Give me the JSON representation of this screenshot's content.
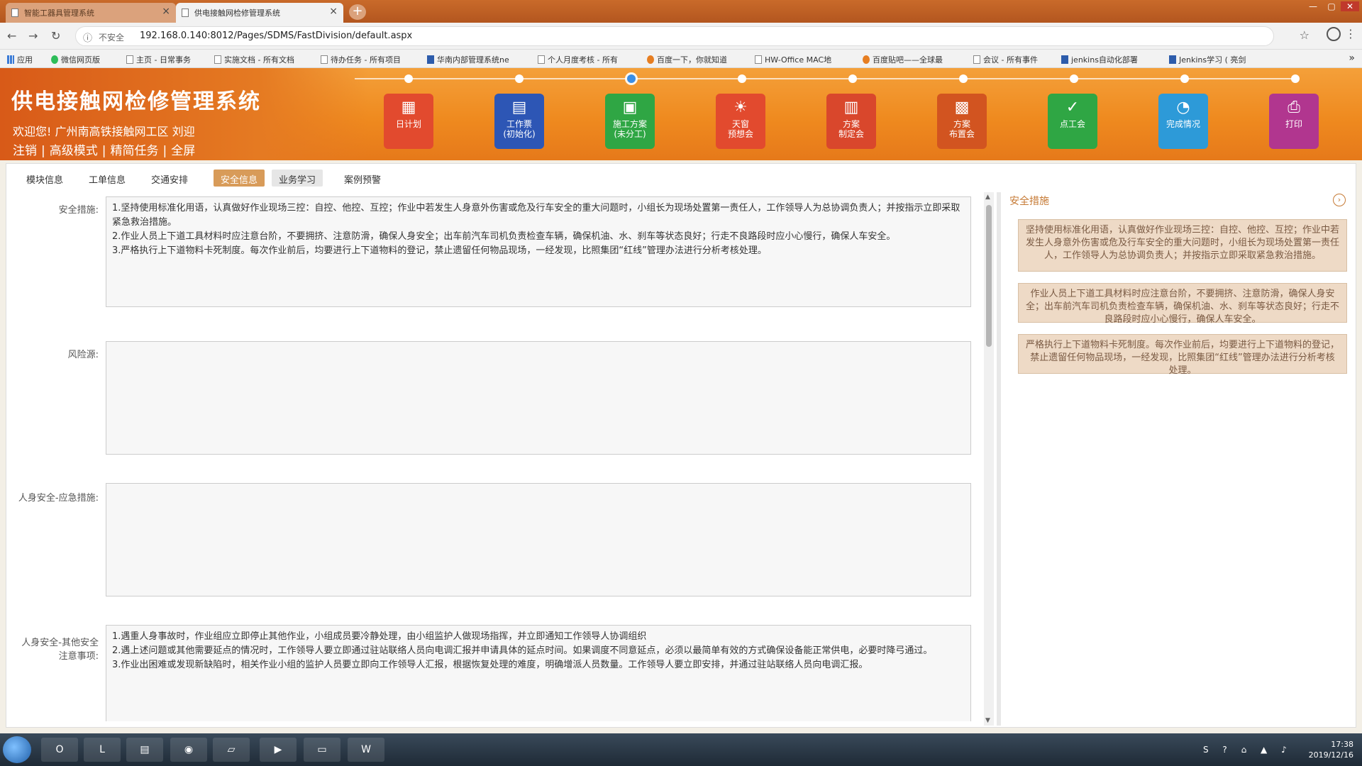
{
  "browser": {
    "tabs": [
      {
        "label": "智能工器具管理系统",
        "active": false
      },
      {
        "label": "供电接触网检修管理系统",
        "active": true
      }
    ],
    "security_label": "不安全",
    "url": "192.168.0.140:8012/Pages/SDMS/FastDivision/default.aspx",
    "bookmarks": [
      {
        "label": "应用",
        "icon": "apps-grid-icon"
      },
      {
        "label": "微信网页版",
        "icon": "wechat-icon"
      },
      {
        "label": "主页 - 日常事务",
        "icon": "page-icon"
      },
      {
        "label": "实施文档 - 所有文档",
        "icon": "page-icon"
      },
      {
        "label": "待办任务 - 所有项目",
        "icon": "page-icon"
      },
      {
        "label": "华南内部管理系统ne",
        "icon": "huawei-icon"
      },
      {
        "label": "个人月度考核 - 所有",
        "icon": "page-icon"
      },
      {
        "label": "百度一下，你就知道",
        "icon": "baidu-icon"
      },
      {
        "label": "HW-Office MAC地",
        "icon": "page-icon"
      },
      {
        "label": "百度贴吧——全球最",
        "icon": "baidu-icon"
      },
      {
        "label": "会议 - 所有事件",
        "icon": "page-icon"
      },
      {
        "label": "jenkins自动化部署",
        "icon": "confluence-icon"
      },
      {
        "label": "Jenkins学习 ( 亮剑",
        "icon": "confluence-icon"
      }
    ]
  },
  "header": {
    "title": "供电接触网检修管理系统",
    "welcome": "欢迎您! 广州南高铁接触网工区 刘迎",
    "links": [
      "注销",
      "高级模式",
      "精简任务",
      "全屏"
    ],
    "modules": [
      {
        "line1": "日计划",
        "line2": "",
        "icon": "calendar-plan-icon",
        "color": "#e24a2e"
      },
      {
        "line1": "工作票",
        "line2": "(初始化)",
        "icon": "ticket-icon",
        "color": "#2d56b5"
      },
      {
        "line1": "施工方案",
        "line2": "(未分工)",
        "icon": "document-plan-icon",
        "color": "#2fa644"
      },
      {
        "line1": "天窗",
        "line2": "预想会",
        "icon": "lightbulb-icon",
        "color": "#e24a2e"
      },
      {
        "line1": "方案",
        "line2": "制定会",
        "icon": "document-plan-icon",
        "color": "#d9472c"
      },
      {
        "line1": "方案",
        "line2": "布置会",
        "icon": "meeting-icon",
        "color": "#d25420"
      },
      {
        "line1": "点工会",
        "line2": "",
        "icon": "check-circle-icon",
        "color": "#2fa644"
      },
      {
        "line1": "完成情况",
        "line2": "",
        "icon": "pie-chart-icon",
        "color": "#2d9ad8"
      },
      {
        "line1": "打印",
        "line2": "",
        "icon": "printer-icon",
        "color": "#b1368f"
      }
    ]
  },
  "subtabs": [
    {
      "label": "模块信息",
      "state": "normal"
    },
    {
      "label": "工单信息",
      "state": "normal"
    },
    {
      "label": "交通安排",
      "state": "normal"
    },
    {
      "label": "安全信息",
      "state": "active"
    },
    {
      "label": "业务学习",
      "state": "hover"
    },
    {
      "label": "案例预警",
      "state": "normal"
    }
  ],
  "form": {
    "safety_measures": {
      "label": "安全措施:",
      "lines": [
        "1.坚持使用标准化用语，认真做好作业现场三控：自控、他控、互控；作业中若发生人身意外伤害或危及行车安全的重大问题时，小组长为现场处置第一责任人，工作领导人为总协调负责人；并按指示立即采取紧急救治措施。",
        "2.作业人员上下道工具材料时应注意台阶，不要拥挤、注意防滑，确保人身安全；出车前汽车司机负责检查车辆，确保机油、水、刹车等状态良好；行走不良路段时应小心慢行，确保人车安全。",
        "3.严格执行上下道物料卡死制度。每次作业前后，均要进行上下道物料的登记，禁止遗留任何物品现场，一经发现，比照集团“红线”管理办法进行分析考核处理。"
      ]
    },
    "risk_source": {
      "label": "风险源:",
      "value": ""
    },
    "personal_safety_emergency": {
      "label": "人身安全-应急措施:",
      "value": ""
    },
    "personal_safety_other": {
      "label": "人身安全-其他安全注意事项:",
      "lines": [
        "1.遇重人身事故时，作业组应立即停止其他作业，小组成员要冷静处理，由小组监护人做现场指挥，并立即通知工作领导人协调组织",
        "2.遇上述问题或其他需要延点的情况时，工作领导人要立即通过驻站联络人员向电调汇报并申请具体的延点时间。如果调度不同意延点，必须以最简单有效的方式确保设备能正常供电，必要时降弓通过。",
        "3.作业出困难或发现新缺陷时，相关作业小组的监护人员要立即向工作领导人汇报，根据恢复处理的难度，明确增派人员数量。工作领导人要立即安排，并通过驻站联络人员向电调汇报。"
      ]
    }
  },
  "side_panel": {
    "title": "安全措施",
    "cards": [
      "坚持使用标准化用语，认真做好作业现场三控：自控、他控、互控；作业中若发生人身意外伤害或危及行车安全的重大问题时，小组长为现场处置第一责任人，工作领导人为总协调负责人；并按指示立即采取紧急救治措施。",
      "作业人员上下道工具材料时应注意台阶，不要拥挤、注意防滑，确保人身安全；出车前汽车司机负责检查车辆，确保机油、水、刹车等状态良好；行走不良路段时应小心慢行，确保人车安全。",
      "严格执行上下道物料卡死制度。每次作业前后，均要进行上下道物料的登记，禁止遗留任何物品现场，一经发现，比照集团“红线”管理办法进行分析考核处理。"
    ]
  },
  "taskbar": {
    "apps": [
      {
        "label": "O",
        "icon": "outlook-icon"
      },
      {
        "label": "L",
        "icon": "lync-icon"
      },
      {
        "label": "▤",
        "icon": "explorer-icon"
      },
      {
        "label": "◉",
        "icon": "chrome-icon"
      },
      {
        "label": "▱",
        "icon": "notes-icon"
      },
      {
        "label": "▶",
        "icon": "media-icon"
      },
      {
        "label": "▭",
        "icon": "folder-icon"
      },
      {
        "label": "W",
        "icon": "word-icon"
      }
    ],
    "time": "17:38",
    "date": "2019/12/16"
  },
  "colors": {
    "header_orange": "#ef8a1f",
    "active_tab": "#d89b59",
    "side_card_bg": "#eedac6"
  }
}
